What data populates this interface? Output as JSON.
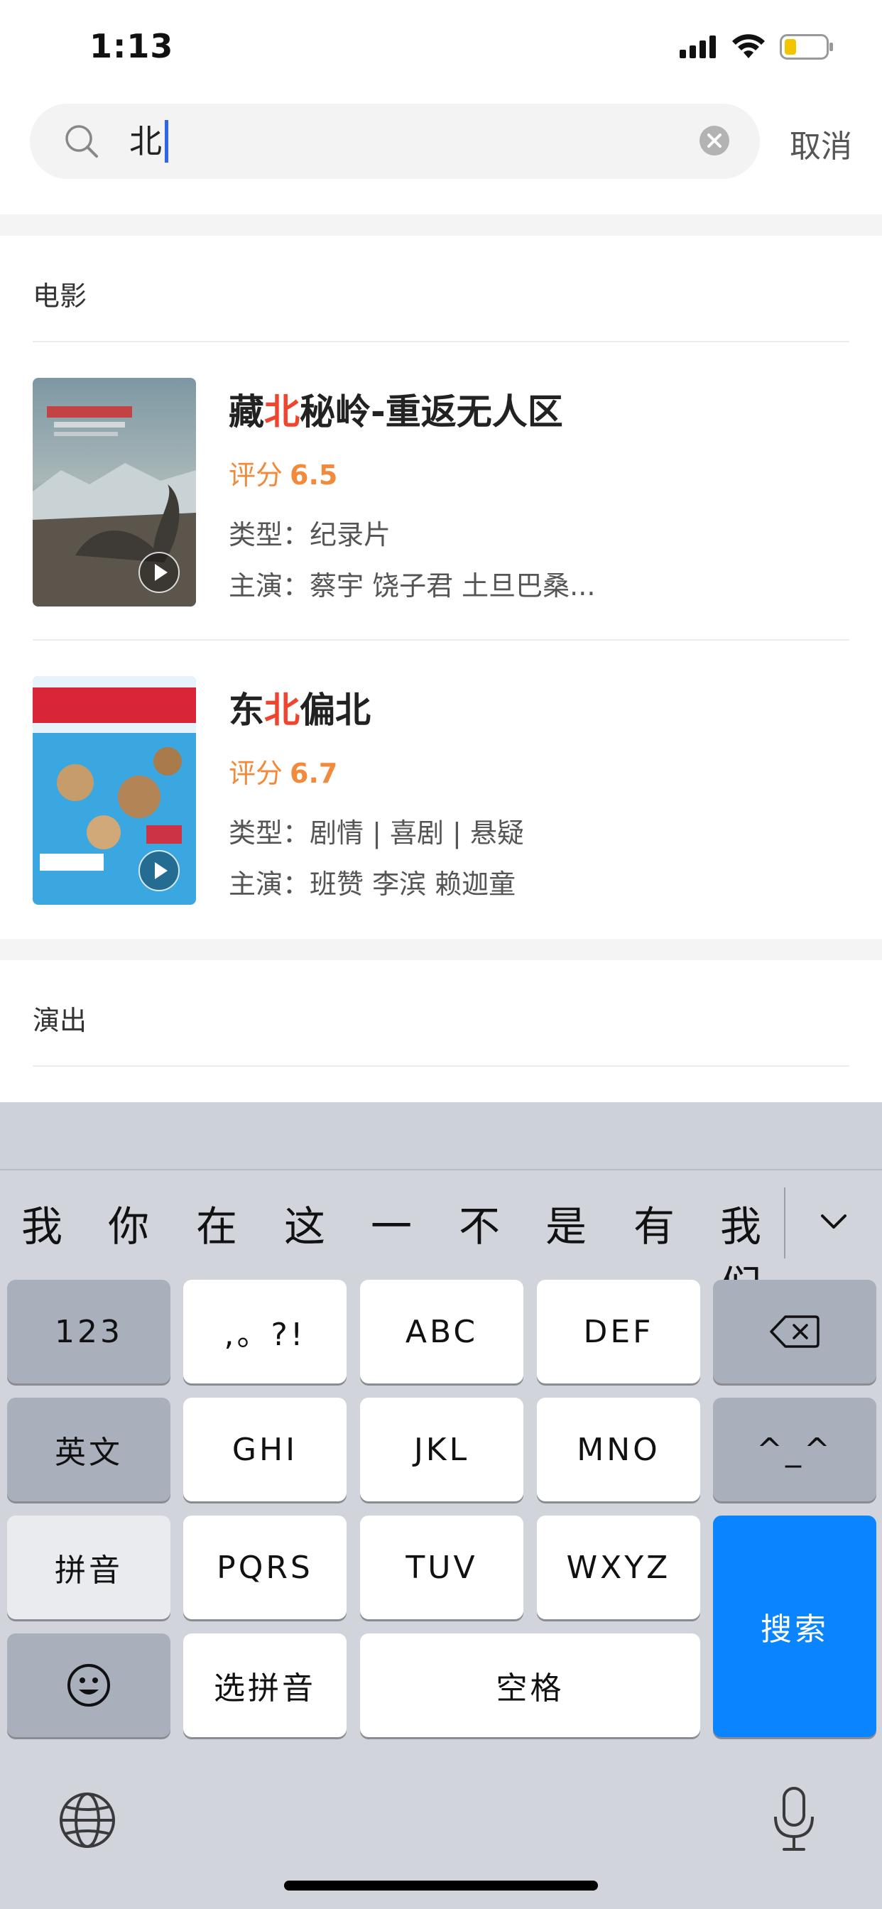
{
  "status_bar": {
    "time": "1:13"
  },
  "search": {
    "query": "北",
    "cancel_label": "取消"
  },
  "sections": {
    "movies_title": "电影",
    "shows_title": "演出"
  },
  "movies": [
    {
      "title_pre": "藏",
      "title_hl": "北",
      "title_post": "秘岭-重返无人区",
      "rating_label": "评分",
      "rating": "6.5",
      "genre": "类型：纪录片",
      "cast": "主演：蔡宇 饶子君 土旦巴桑..."
    },
    {
      "title_pre": "东",
      "title_hl": "北",
      "title_post": "偏北",
      "rating_label": "评分",
      "rating": "6.7",
      "genre": "类型：剧情 | 喜剧 | 悬疑",
      "cast": "主演：班赞 李滨 赖迦童"
    }
  ],
  "keyboard": {
    "candidates": [
      "我",
      "你",
      "在",
      "这",
      "一",
      "不",
      "是",
      "有",
      "我们"
    ],
    "keys": {
      "num": "123",
      "punct": ",。?!",
      "abc": "ABC",
      "def": "DEF",
      "english": "英文",
      "ghi": "GHI",
      "jkl": "JKL",
      "mno": "MNO",
      "face": "^_^",
      "pinyin": "拼音",
      "pqrs": "PQRS",
      "tuv": "TUV",
      "wxyz": "WXYZ",
      "search": "搜索",
      "select_pinyin": "选拼音",
      "space": "空格"
    }
  },
  "colors": {
    "highlight": "#f0442f",
    "rating": "#f28a3b",
    "caret": "#2f66e8",
    "search_key": "#0a84ff"
  }
}
